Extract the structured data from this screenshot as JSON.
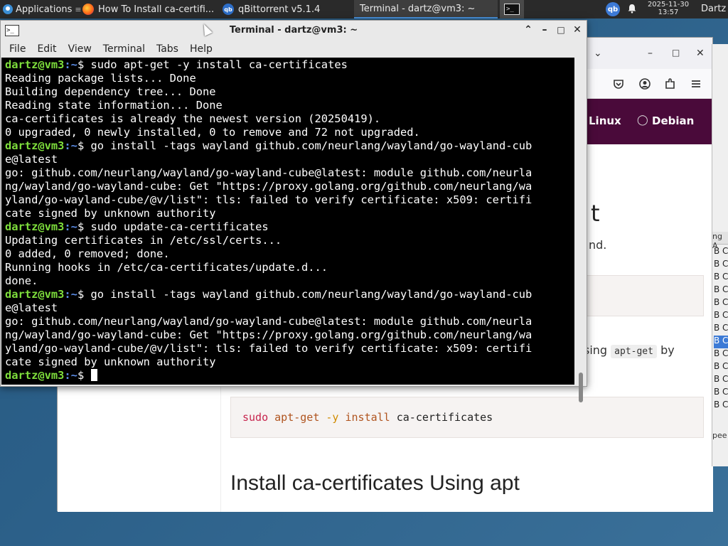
{
  "panel": {
    "applications_label": "Applications",
    "tasks": [
      {
        "label": "How To Install ca-certifi...",
        "icon": "firefox-icon"
      },
      {
        "label": "qBittorrent v5.1.4",
        "icon": "qbittorrent-icon"
      },
      {
        "label": "Terminal - dartz@vm3: ~",
        "icon": "terminal-icon"
      }
    ],
    "terminal_launcher": ">_",
    "tray_qb": "qb",
    "clock_date": "2025-11-30",
    "clock_time": "13:57",
    "user": "Dartz"
  },
  "terminal": {
    "title": "Terminal - dartz@vm3: ~",
    "menu": [
      "File",
      "Edit",
      "View",
      "Terminal",
      "Tabs",
      "Help"
    ],
    "prompt_user": "dartz@vm3",
    "prompt_path": ":~",
    "prompt_sym": "$ ",
    "lines": [
      {
        "type": "prompt",
        "text": "sudo apt-get -y install ca-certificates"
      },
      {
        "type": "out",
        "text": "Reading package lists... Done"
      },
      {
        "type": "out",
        "text": "Building dependency tree... Done"
      },
      {
        "type": "out",
        "text": "Reading state information... Done"
      },
      {
        "type": "out",
        "text": "ca-certificates is already the newest version (20250419)."
      },
      {
        "type": "out",
        "text": "0 upgraded, 0 newly installed, 0 to remove and 72 not upgraded."
      },
      {
        "type": "prompt",
        "text": "go install -tags wayland github.com/neurlang/wayland/go-wayland-cub"
      },
      {
        "type": "out",
        "text": "e@latest"
      },
      {
        "type": "out",
        "text": "go: github.com/neurlang/wayland/go-wayland-cube@latest: module github.com/neurla"
      },
      {
        "type": "out",
        "text": "ng/wayland/go-wayland-cube: Get \"https://proxy.golang.org/github.com/neurlang/wa"
      },
      {
        "type": "out",
        "text": "yland/go-wayland-cube/@v/list\": tls: failed to verify certificate: x509: certifi"
      },
      {
        "type": "out",
        "text": "cate signed by unknown authority"
      },
      {
        "type": "prompt",
        "text": "sudo update-ca-certificates"
      },
      {
        "type": "out",
        "text": "Updating certificates in /etc/ssl/certs..."
      },
      {
        "type": "out",
        "text": "0 added, 0 removed; done."
      },
      {
        "type": "out",
        "text": "Running hooks in /etc/ca-certificates/update.d..."
      },
      {
        "type": "out",
        "text": "done."
      },
      {
        "type": "prompt",
        "text": "go install -tags wayland github.com/neurlang/wayland/go-wayland-cub"
      },
      {
        "type": "out",
        "text": "e@latest"
      },
      {
        "type": "out",
        "text": "go: github.com/neurlang/wayland/go-wayland-cube@latest: module github.com/neurla"
      },
      {
        "type": "out",
        "text": "ng/wayland/go-wayland-cube: Get \"https://proxy.golang.org/github.com/neurlang/wa"
      },
      {
        "type": "out",
        "text": "yland/go-wayland-cube/@v/list\": tls: failed to verify certificate: x509: certifi"
      },
      {
        "type": "out",
        "text": "cate signed by unknown authority"
      },
      {
        "type": "current",
        "text": ""
      }
    ]
  },
  "browser": {
    "nav_links": [
      "Linux",
      "Debian"
    ],
    "heading_fragment": "t",
    "text_fragment": "nd.",
    "using_prefix": "sing",
    "using_code": "apt-get",
    "using_suffix": "by",
    "code_tokens": [
      "sudo",
      "apt-get",
      "-y",
      "install",
      "ca-certificates"
    ],
    "section_heading": "Install ca-certificates Using apt"
  },
  "qbittorrent": {
    "column_header": "ng A",
    "row_letter": "B C",
    "speed_fragment": "pee"
  }
}
